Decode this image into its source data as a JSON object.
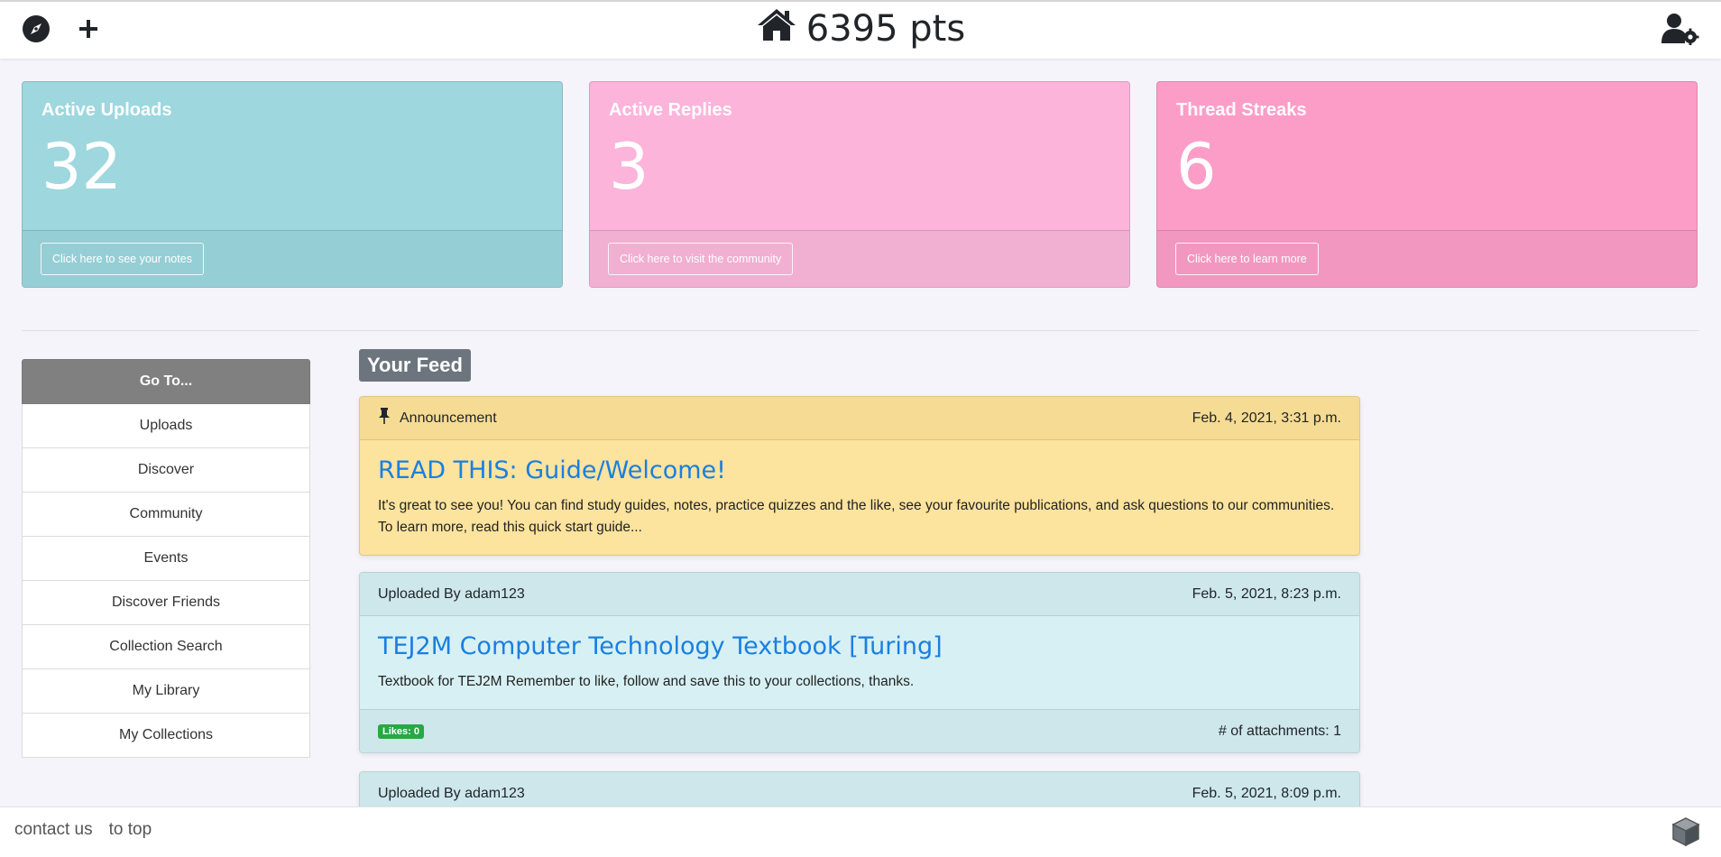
{
  "navbar": {
    "compass_icon": "compass-icon",
    "plus_icon": "plus-icon",
    "home_icon": "home-icon",
    "points": "6395 pts",
    "user_settings_icon": "user-cog-icon"
  },
  "cards": [
    {
      "title": "Active Uploads",
      "value": "32",
      "button": "Click here to see your notes",
      "color": "#9ed7de"
    },
    {
      "title": "Active Replies",
      "value": "3",
      "button": "Click here to visit the community",
      "color": "#fcb4db"
    },
    {
      "title": "Thread Streaks",
      "value": "6",
      "button": "Click here to learn more",
      "color": "#fc9dc8"
    }
  ],
  "sidebar": {
    "header": "Go To...",
    "items": [
      {
        "label": "Uploads"
      },
      {
        "label": "Discover"
      },
      {
        "label": "Community"
      },
      {
        "label": "Events"
      },
      {
        "label": "Discover Friends"
      },
      {
        "label": "Collection Search"
      },
      {
        "label": "My Library"
      },
      {
        "label": "My Collections"
      }
    ]
  },
  "feed": {
    "title": "Your Feed",
    "posts": [
      {
        "header_left": "Announcement",
        "date": "Feb. 4, 2021, 3:31 p.m.",
        "title": "READ THIS: Guide/Welcome!",
        "text": "It's great to see you! You can find study guides, notes, practice quizzes and the like, see your favourite publications, and ask questions to our communities. To learn more, read this quick start guide..."
      },
      {
        "header_left": "Uploaded By adam123",
        "date": "Feb. 5, 2021, 8:23 p.m.",
        "title": "TEJ2M Computer Technology Textbook [Turing]",
        "text": "Textbook for TEJ2M Remember to like, follow and save this to your collections, thanks.",
        "likes": "Likes: 0",
        "attachments": "# of attachments: 1"
      },
      {
        "header_left": "Uploaded By adam123",
        "date": "Feb. 5, 2021, 8:09 p.m."
      }
    ]
  },
  "footer": {
    "contact": "contact us",
    "to_top": "to top",
    "cube_icon": "cube-icon"
  }
}
